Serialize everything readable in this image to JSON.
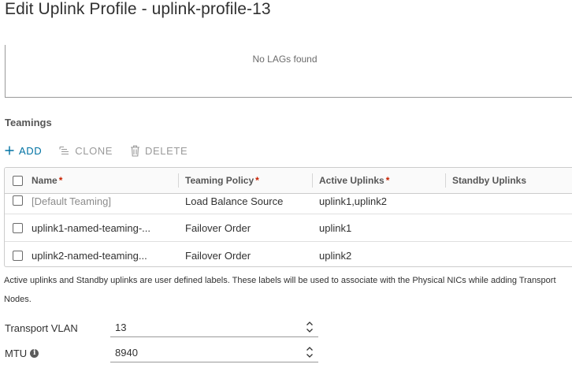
{
  "page": {
    "title": "Edit Uplink Profile - uplink-profile-13"
  },
  "lags": {
    "empty_text": "No LAGs found"
  },
  "teamings": {
    "section_title": "Teamings",
    "toolbar": {
      "add": "ADD",
      "clone": "CLONE",
      "delete": "DELETE"
    },
    "columns": [
      {
        "label": "Name",
        "required": "*"
      },
      {
        "label": "Teaming Policy",
        "required": "*"
      },
      {
        "label": "Active Uplinks",
        "required": "*"
      },
      {
        "label": "Standby Uplinks",
        "required": ""
      }
    ],
    "rows": [
      {
        "name": "[Default Teaming]",
        "policy": "Load Balance Source",
        "active": "uplink1,uplink2",
        "standby": ""
      },
      {
        "name": "uplink1-named-teaming-...",
        "policy": "Failover Order",
        "active": "uplink1",
        "standby": ""
      },
      {
        "name": "uplink2-named-teaming...",
        "policy": "Failover Order",
        "active": "uplink2",
        "standby": ""
      }
    ],
    "note": "Active uplinks and Standby uplinks are user defined labels. These labels will be used to associate with the Physical NICs while adding Transport Nodes."
  },
  "form": {
    "transport_vlan": {
      "label": "Transport VLAN",
      "value": "13"
    },
    "mtu": {
      "label": "MTU",
      "value": "8940",
      "info_icon": "info-icon"
    }
  },
  "colors": {
    "accent": "#0072a3",
    "required": "#c92100",
    "disabled": "#9a9a9a"
  }
}
